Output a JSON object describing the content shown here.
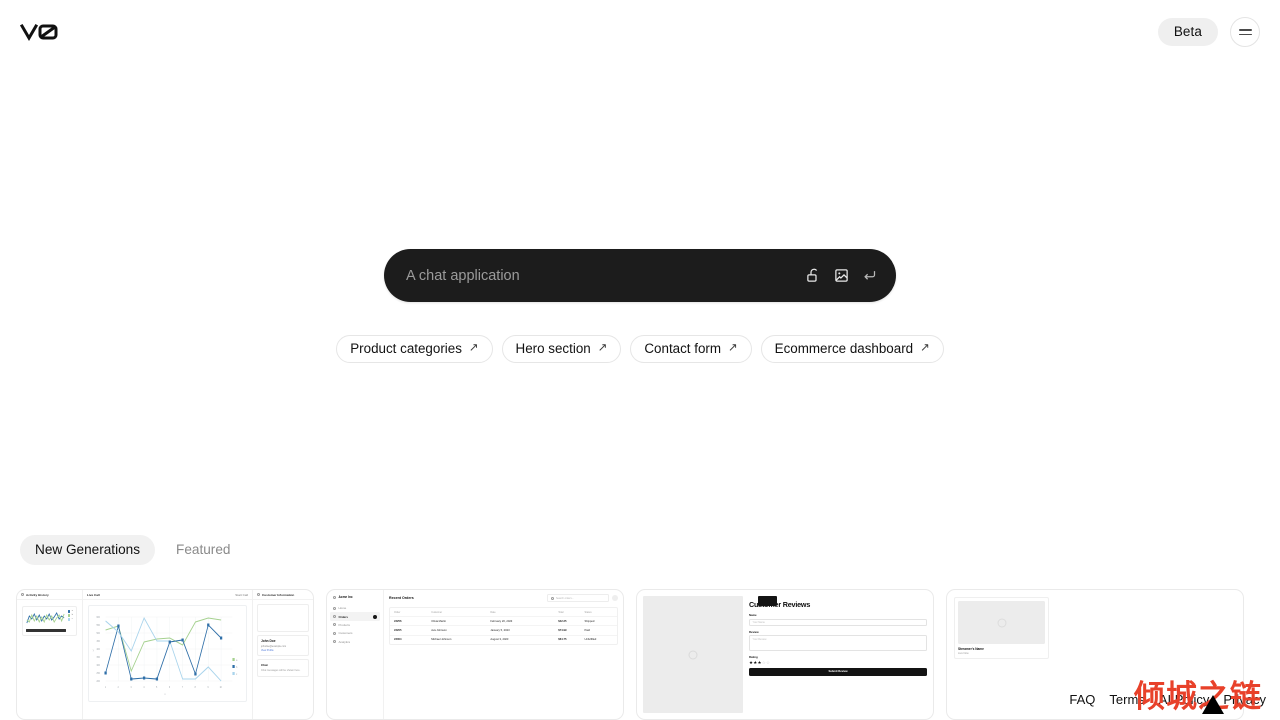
{
  "header": {
    "logo_name": "v0-logo",
    "beta_label": "Beta",
    "menu_icon": "hamburger-menu-icon"
  },
  "prompt": {
    "placeholder": "A chat application",
    "value": "",
    "icons": [
      "unlock-icon",
      "image-icon",
      "enter-return-icon"
    ]
  },
  "suggestions": [
    {
      "label": "Product categories",
      "arrow": "↗"
    },
    {
      "label": "Hero section",
      "arrow": "↗"
    },
    {
      "label": "Contact form",
      "arrow": "↗"
    },
    {
      "label": "Ecommerce dashboard",
      "arrow": "↗"
    }
  ],
  "tabs": [
    {
      "label": "New Generations",
      "active": true
    },
    {
      "label": "Featured",
      "active": false
    }
  ],
  "cards": {
    "support_dashboard": {
      "activity_history": "Activity History",
      "live_call": "Live Call",
      "start_call": "Start Call",
      "customer_information": "Customer Information",
      "customer_name": "John Doe",
      "customer_email": "johndoe@example.com",
      "view_profile": "View Profile",
      "chat_title": "Chat",
      "chat_empty": "Chat messages will be shown here.",
      "legend": [
        "a",
        "b",
        "c"
      ]
    },
    "acme_orders": {
      "brand": "Acme Inc",
      "nav": [
        "Home",
        "Orders",
        "Products",
        "Customers",
        "Analytics"
      ],
      "active_nav": "Orders",
      "title": "Recent Orders",
      "search_placeholder": "Search orders...",
      "columns": [
        "Order",
        "Customer",
        "Date",
        "Total",
        "Status"
      ],
      "rows": [
        {
          "order": "#3256",
          "customer": "Olivia Martin",
          "date": "February 20, 2023",
          "total": "$42.25",
          "status": "Shipped"
        },
        {
          "order": "#3205",
          "customer": "Ava Johnson",
          "date": "January 5, 2023",
          "total": "$74.99",
          "status": "Paid"
        },
        {
          "order": "#3004",
          "customer": "Michael Johnson",
          "date": "August 3, 2023",
          "total": "$64.75",
          "status": "Unfulfilled"
        }
      ]
    },
    "customer_reviews": {
      "title": "Customer Reviews",
      "name_label": "Name",
      "name_placeholder": "Your Name",
      "review_label": "Review",
      "review_placeholder": "Your Review",
      "rating_label": "Rating",
      "rating_value": 3,
      "rating_max": 5,
      "submit_label": "Submit Review"
    },
    "streamer": {
      "name": "Streamer's Name",
      "status": "Live Now"
    }
  },
  "footer": {
    "links": [
      "FAQ",
      "Terms",
      "AI Policy",
      "Privacy"
    ],
    "watermark": "倾城之链"
  },
  "chart_data": {
    "type": "line",
    "title": "Live Call",
    "xlabel": "x",
    "ylabel": "y",
    "x": [
      1,
      2,
      3,
      4,
      5,
      6,
      7,
      8,
      9,
      10
    ],
    "ylim": [
      0,
      600
    ],
    "grid": true,
    "legend": "right",
    "series": [
      {
        "name": "a",
        "color": "#a5d18f",
        "values": [
          430,
          480,
          140,
          330,
          360,
          370,
          300,
          520,
          560,
          540
        ]
      },
      {
        "name": "b",
        "color": "#2f6fa8",
        "values": [
          120,
          480,
          60,
          75,
          62,
          330,
          350,
          110,
          490,
          370
        ]
      },
      {
        "name": "c",
        "color": "#a9d4ec",
        "values": [
          520,
          420,
          290,
          560,
          340,
          345,
          60,
          62,
          175,
          45
        ]
      }
    ]
  }
}
